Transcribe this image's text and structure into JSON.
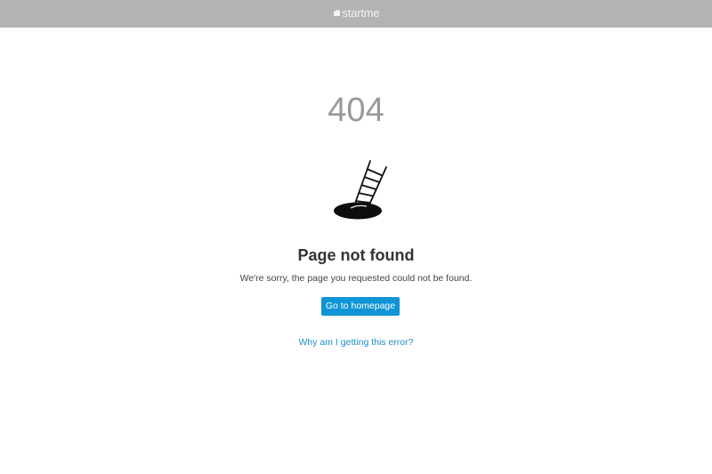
{
  "header": {
    "logo_text": "startme",
    "logo_icon": "startme-logo-icon"
  },
  "error": {
    "code": "404",
    "illustration_icon": "ladder-in-hole-icon",
    "title": "Page not found",
    "message": "We're sorry, the page you requested could not be found."
  },
  "actions": {
    "homepage_button_label": "Go to homepage",
    "help_link_label": "Why am I getting this error?"
  },
  "colors": {
    "header_background": "#b3b3b3",
    "button_background": "#0f95d6",
    "link": "#1b8fcb",
    "code_text": "#999999"
  }
}
